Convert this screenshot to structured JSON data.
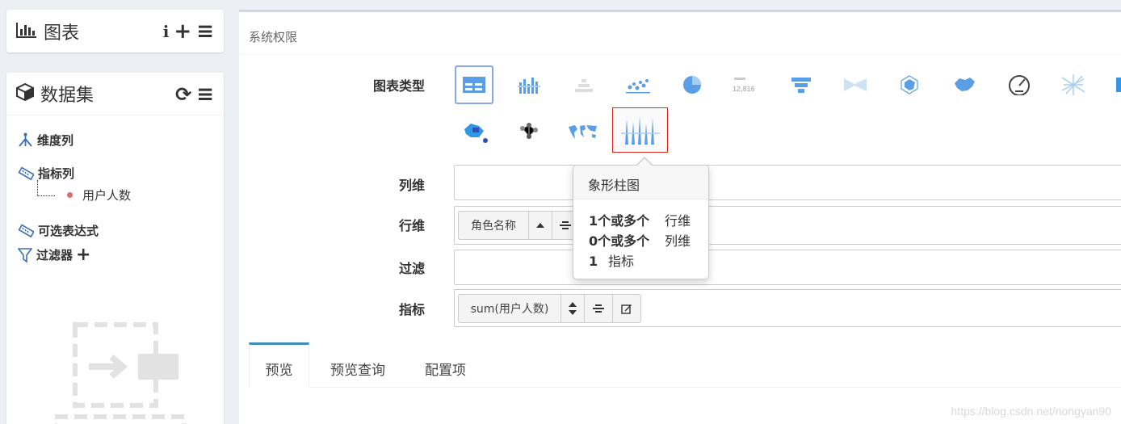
{
  "sidebar": {
    "chart_box": {
      "title": "图表",
      "icons": [
        "bar-chart-icon",
        "info-icon",
        "plus-icon",
        "menu-icon"
      ],
      "info_glyph": "i",
      "plus_glyph": "+",
      "menu_glyph": "≡"
    },
    "dataset_box": {
      "title": "数据集",
      "icons": [
        "cube-icon",
        "refresh-icon",
        "menu-icon"
      ],
      "refresh_glyph": "⟳",
      "menu_glyph": "≡",
      "dimension_label": "维度列",
      "measure_label": "指标列",
      "measure_item": "用户人数",
      "expression_label": "可选表达式",
      "filter_label": "过滤器",
      "filter_add_glyph": "+"
    }
  },
  "main": {
    "title": "系统权限",
    "chart_type_label": "图表类型",
    "chart_types": [
      "table-icon",
      "bar-icon",
      "stacked-bar-icon",
      "scatter-icon",
      "pie-icon",
      "kpi-icon",
      "funnel-icon",
      "sankey-icon",
      "radar-icon",
      "china-map-icon",
      "gauge-icon",
      "word-cloud-icon",
      "heatmap-icon",
      "relation-map-icon",
      "graph-icon",
      "world-map-icon",
      "pictorial-bar-icon"
    ],
    "kpi_text": "12,816",
    "fields": {
      "column_label": "列维",
      "row_label": "行维",
      "filter_label": "过滤",
      "measure_label": "指标",
      "row_chip": "角色名称",
      "measure_chip": "sum(用户人数)"
    },
    "tooltip": {
      "title": "象形柱图",
      "rows": [
        {
          "req": "1个或多个",
          "name": "行维"
        },
        {
          "req": "0个或多个",
          "name": "列维"
        },
        {
          "req": "1",
          "name": "指标"
        }
      ]
    },
    "tabs": [
      "预览",
      "预览查询",
      "配置项"
    ]
  },
  "watermark": "https://blog.csdn.net/nongyan90",
  "colors": {
    "accent": "#3c8dbc",
    "active_border": "#89a7e8",
    "highlight_border": "#e0251f",
    "measure_dot": "#e26c6c",
    "icon_blue": "#5a9fe6"
  }
}
